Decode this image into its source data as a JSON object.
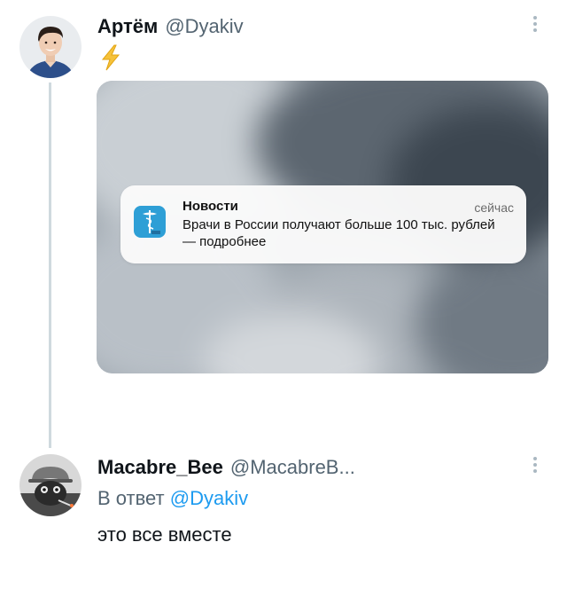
{
  "tweet": {
    "author_name": "Артём",
    "author_handle": "@Dyakiv",
    "emoji_icon": "lightning-bolt-emoji",
    "media": {
      "notification": {
        "app_name": "Новости",
        "time": "сейчас",
        "body": "Врачи в России получают больше 100 тыс. рублей — подробнее",
        "icon": "caduceus-app-icon",
        "icon_color": "#2e9fd6"
      }
    }
  },
  "reply": {
    "author_name": "Macabre_Bee",
    "author_handle": "@MacabreB...",
    "reply_prefix": "В ответ",
    "reply_to": "@Dyakiv",
    "text": "это все вместе"
  },
  "colors": {
    "accent": "#1d9bf0",
    "secondary_text": "#536471",
    "thread_line": "#cfd9de"
  }
}
